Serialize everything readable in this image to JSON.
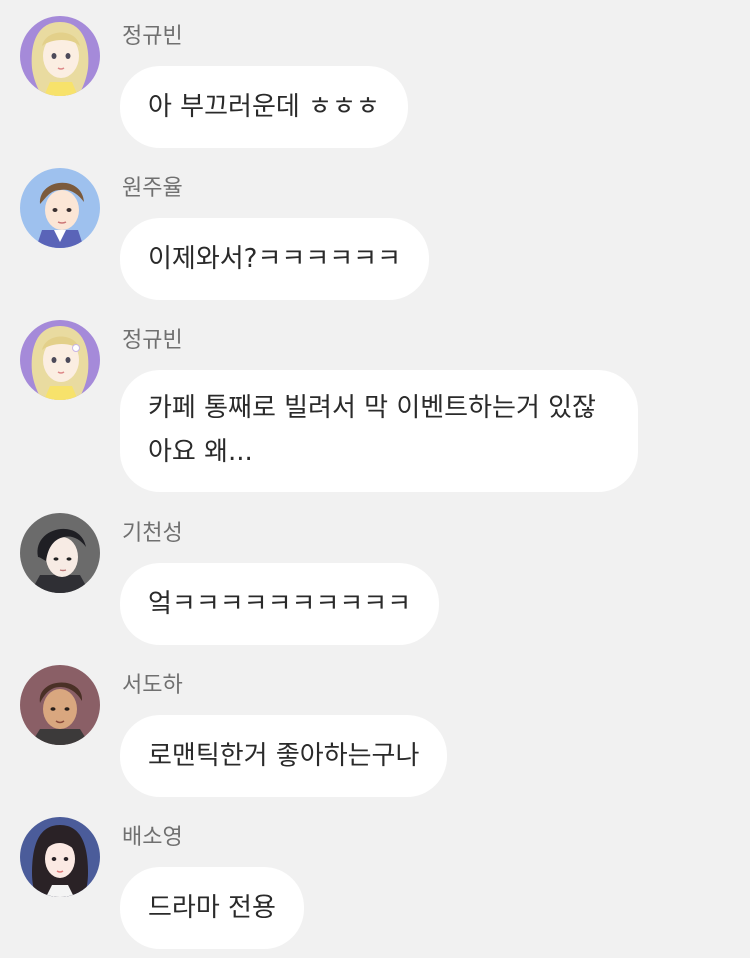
{
  "messages": [
    {
      "sender": "정규빈",
      "text": "아 부끄러운데 ㅎㅎㅎ",
      "avatar_icon": "blonde-girl-avatar-icon"
    },
    {
      "sender": "원주율",
      "text": "이제와서?ㅋㅋㅋㅋㅋㅋ",
      "avatar_icon": "brown-hair-boy-avatar-icon"
    },
    {
      "sender": "정규빈",
      "text_lines": [
        "카페 통째로 빌려서 막 이벤트하는거 있잖",
        "아요 왜..."
      ],
      "avatar_icon": "blonde-girl-avatar-icon"
    },
    {
      "sender": "기천성",
      "text": "엌ㅋㅋㅋㅋㅋㅋㅋㅋㅋㅋ",
      "avatar_icon": "black-hair-boy-avatar-icon"
    },
    {
      "sender": "서도하",
      "text": "로맨틱한거 좋아하는구나",
      "avatar_icon": "tan-boy-avatar-icon"
    },
    {
      "sender": "배소영",
      "text": "드라마 전용",
      "avatar_icon": "dark-hair-girl-avatar-icon"
    }
  ],
  "colors": {
    "background": "#f1f1f1",
    "bubble": "#ffffff",
    "sender_text": "#707070",
    "message_text": "#2a2a2a"
  }
}
